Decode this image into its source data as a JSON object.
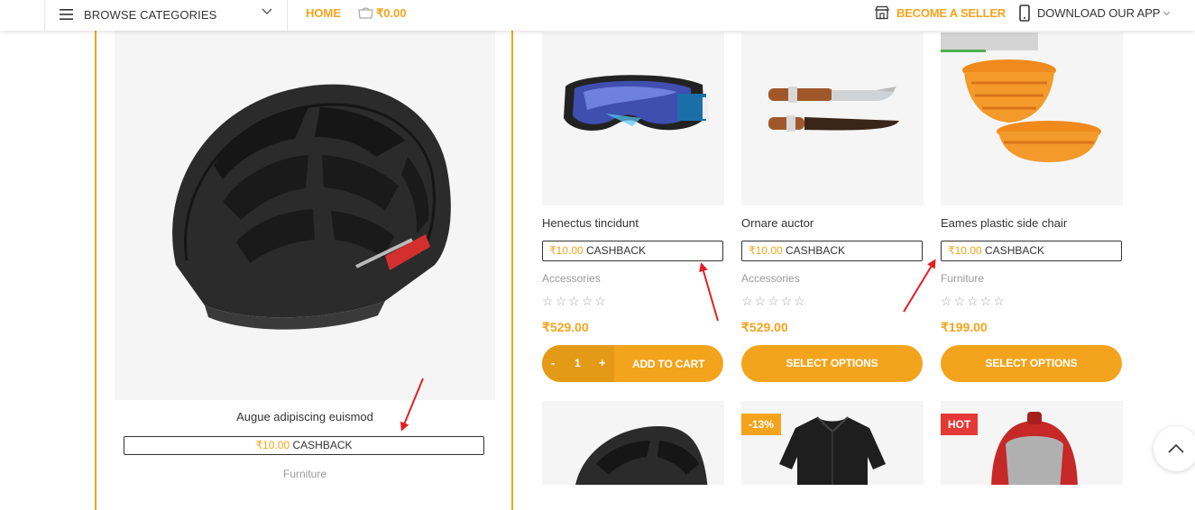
{
  "header": {
    "browse_label": "BROWSE CATEGORIES",
    "home_label": "HOME",
    "cart_total": "₹0.00",
    "seller_label": "BECOME A SELLER",
    "app_label": "DOWNLOAD OUR APP"
  },
  "featured": {
    "title": "Augue adipiscing euismod",
    "cashback_amount": "₹10.00",
    "cashback_label": "CASHBACK",
    "category": "Furniture"
  },
  "products": [
    {
      "title": "Henectus tincidunt",
      "cashback_amount": "₹10.00",
      "cashback_label": "CASHBACK",
      "category": "Accessories",
      "rating": 0,
      "price": "₹529.00",
      "quantity": "1",
      "qty_minus": "-",
      "qty_plus": "+",
      "button": "ADD TO CART"
    },
    {
      "title": "Ornare auctor",
      "cashback_amount": "₹10.00",
      "cashback_label": "CASHBACK",
      "category": "Accessories",
      "rating": 0,
      "price": "₹529.00",
      "button": "SELECT OPTIONS"
    },
    {
      "title": "Eames plastic side chair",
      "cashback_amount": "₹10.00",
      "cashback_label": "CASHBACK",
      "category": "Furniture",
      "rating": 0,
      "price": "₹199.00",
      "button": "SELECT OPTIONS"
    }
  ],
  "row2_badges": {
    "discount": "-13%",
    "hot": "HOT"
  },
  "colors": {
    "accent": "#f3a41c",
    "hot": "#e53935",
    "annotation_arrow": "#e31e24"
  },
  "icons": {
    "menu": "hamburger-icon",
    "cart": "cart-icon",
    "store": "store-icon",
    "phone": "phone-icon",
    "scroll_top": "chevron-up-icon"
  }
}
